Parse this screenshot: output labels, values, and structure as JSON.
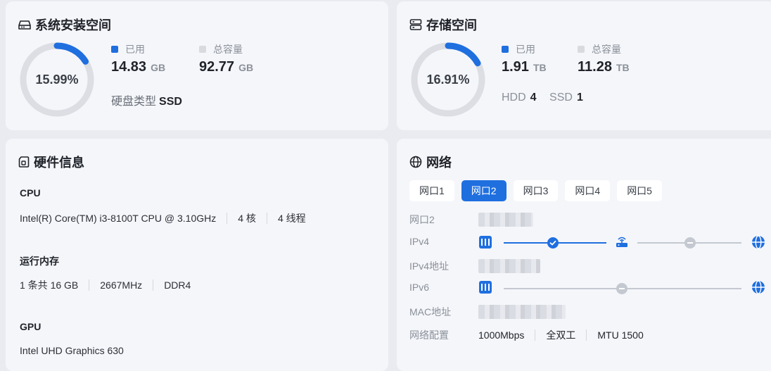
{
  "system": {
    "title": "系统安装空间",
    "percent": "15.99%",
    "used_fraction": 0.1599,
    "used_label": "已用",
    "used_value": "14.83",
    "used_unit": "GB",
    "total_label": "总容量",
    "total_value": "92.77",
    "total_unit": "GB",
    "disk_type_label": "硬盘类型",
    "disk_type_value": "SSD"
  },
  "storage": {
    "title": "存储空间",
    "percent": "16.91%",
    "used_fraction": 0.1691,
    "used_label": "已用",
    "used_value": "1.91",
    "used_unit": "TB",
    "total_label": "总容量",
    "total_value": "11.28",
    "total_unit": "TB",
    "hdd_label": "HDD",
    "hdd_count": "4",
    "ssd_label": "SSD",
    "ssd_count": "1"
  },
  "hardware": {
    "title": "硬件信息",
    "cpu_label": "CPU",
    "cpu_model": "Intel(R) Core(TM) i3-8100T CPU @ 3.10GHz",
    "cpu_cores": "4 核",
    "cpu_threads": "4 线程",
    "mem_label": "运行内存",
    "mem_size": "1 条共 16 GB",
    "mem_freq": "2667MHz",
    "mem_type": "DDR4",
    "gpu_label": "GPU",
    "gpu_model": "Intel UHD Graphics 630"
  },
  "network": {
    "title": "网络",
    "tabs": [
      "网口1",
      "网口2",
      "网口3",
      "网口4",
      "网口5"
    ],
    "active_tab": 1,
    "port_label": "网口2",
    "ipv4_label": "IPv4",
    "ipv4_addr_label": "IPv4地址",
    "ipv6_label": "IPv6",
    "mac_label": "MAC地址",
    "config_label": "网络配置",
    "speed": "1000Mbps",
    "duplex": "全双工",
    "mtu": "MTU 1500"
  },
  "colors": {
    "accent": "#1f6fdf",
    "track": "#dcdee3",
    "total_dot": "#d8dade",
    "inactive_line": "#c4c8d0"
  }
}
